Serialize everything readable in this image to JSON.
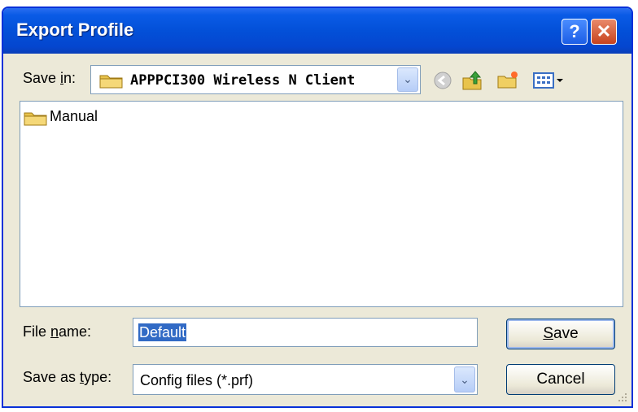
{
  "window": {
    "title": "Export Profile",
    "help_glyph": "?",
    "close_glyph": "✕"
  },
  "toolbar": {
    "save_in_label_pre": "Save ",
    "save_in_label_u": "i",
    "save_in_label_post": "n:",
    "save_in_value": "APPPCI300 Wireless N Client",
    "icons": [
      "folder-icon",
      "back-icon",
      "up-folder-icon",
      "new-folder-icon",
      "views-menu-icon"
    ]
  },
  "files": [
    {
      "name": "Manual",
      "icon": "folder-icon"
    }
  ],
  "form": {
    "file_name_label_pre": "File ",
    "file_name_label_u": "n",
    "file_name_label_post": "ame:",
    "file_name_value": "Default",
    "save_type_label_pre": "Save as ",
    "save_type_label_u": "t",
    "save_type_label_post": "ype:",
    "save_type_value": "Config files (*.prf)"
  },
  "buttons": {
    "save_u": "S",
    "save_rest": "ave",
    "cancel": "Cancel"
  },
  "colors": {
    "title_bar": "#0a5be6",
    "selection": "#316ac5",
    "dialog_bg": "#ece9d8"
  }
}
